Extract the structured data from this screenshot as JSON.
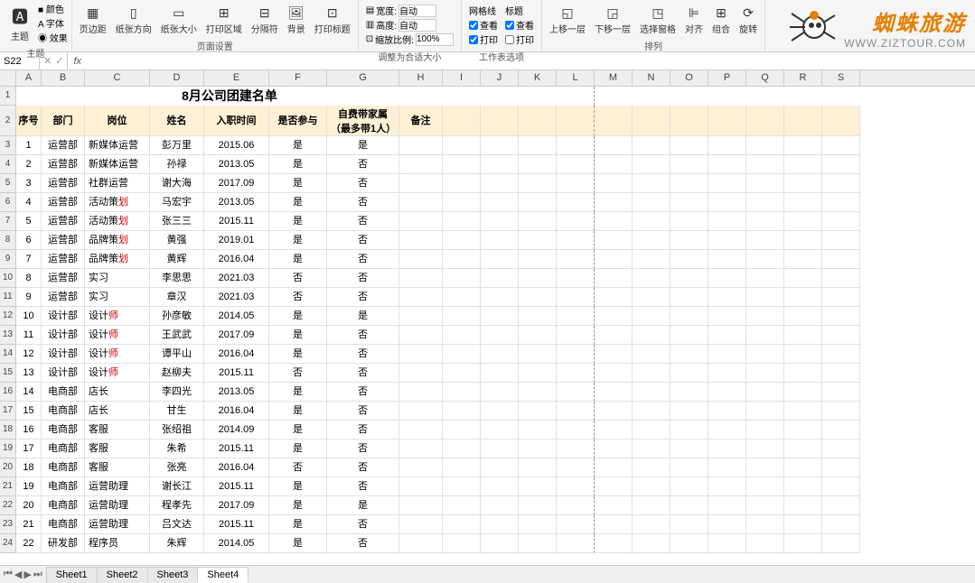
{
  "ribbon": {
    "theme": {
      "label": "主题",
      "sub1": "颜色",
      "sub2": "字体",
      "sub3": "效果",
      "group": "主题"
    },
    "page_setup": {
      "margins": "页边距",
      "orientation": "纸张方向",
      "size": "纸张大小",
      "print_area": "打印区域",
      "breaks": "分隔符",
      "background": "背景",
      "print_titles": "打印标题",
      "group": "页面设置"
    },
    "scale": {
      "width": "宽度:",
      "height": "高度:",
      "zoom": "缩放比例:",
      "auto": "自动",
      "zoom_val": "100%",
      "group": "调整为合适大小"
    },
    "sheet_opts": {
      "gridlines": "网格线",
      "headings": "标题",
      "view": "查看",
      "print": "打印",
      "group": "工作表选项"
    },
    "arrange": {
      "bring_fwd": "上移一层",
      "send_back": "下移一层",
      "selection": "选择窗格",
      "align": "对齐",
      "group_btn": "组合",
      "rotate": "旋转",
      "group": "排列"
    }
  },
  "watermark": {
    "title": "蜘蛛旅游",
    "url": "WWW.ZIZTOUR.COM"
  },
  "formula": {
    "cell_ref": "S22"
  },
  "cols": [
    "A",
    "B",
    "C",
    "D",
    "E",
    "F",
    "G",
    "H",
    "I",
    "J",
    "K",
    "L",
    "M",
    "N",
    "O",
    "P",
    "Q",
    "R",
    "S"
  ],
  "title": "8月公司团建名单",
  "headers": {
    "a": "序号",
    "b": "部门",
    "c": "岗位",
    "d": "姓名",
    "e": "入职时间",
    "f": "是否参与",
    "g": "自费带家属\n（最多带1人）",
    "h": "备注"
  },
  "rows": [
    {
      "n": "1",
      "dept": "运营部",
      "pos": "新媒体运营",
      "name": "彭万里",
      "date": "2015.06",
      "join": "是",
      "fam": "是"
    },
    {
      "n": "2",
      "dept": "运营部",
      "pos": "新媒体运营",
      "name": "孙禄",
      "date": "2013.05",
      "join": "是",
      "fam": "否"
    },
    {
      "n": "3",
      "dept": "运营部",
      "pos": "社群运营",
      "name": "谢大海",
      "date": "2017.09",
      "join": "是",
      "fam": "否"
    },
    {
      "n": "4",
      "dept": "运营部",
      "pos": "活动策划",
      "name": "马宏宇",
      "date": "2013.05",
      "join": "是",
      "fam": "否"
    },
    {
      "n": "5",
      "dept": "运营部",
      "pos": "活动策划",
      "name": "张三三",
      "date": "2015.11",
      "join": "是",
      "fam": "否"
    },
    {
      "n": "6",
      "dept": "运营部",
      "pos": "品牌策划",
      "name": "黄强",
      "date": "2019.01",
      "join": "是",
      "fam": "否"
    },
    {
      "n": "7",
      "dept": "运营部",
      "pos": "品牌策划",
      "name": "黄辉",
      "date": "2016.04",
      "join": "是",
      "fam": "否"
    },
    {
      "n": "8",
      "dept": "运营部",
      "pos": "实习",
      "name": "李思思",
      "date": "2021.03",
      "join": "否",
      "fam": "否"
    },
    {
      "n": "9",
      "dept": "运营部",
      "pos": "实习",
      "name": "章汉",
      "date": "2021.03",
      "join": "否",
      "fam": "否"
    },
    {
      "n": "10",
      "dept": "设计部",
      "pos": "设计师",
      "name": "孙彦敏",
      "date": "2014.05",
      "join": "是",
      "fam": "是"
    },
    {
      "n": "11",
      "dept": "设计部",
      "pos": "设计师",
      "name": "王武武",
      "date": "2017.09",
      "join": "是",
      "fam": "否"
    },
    {
      "n": "12",
      "dept": "设计部",
      "pos": "设计师",
      "name": "谭平山",
      "date": "2016.04",
      "join": "是",
      "fam": "否"
    },
    {
      "n": "13",
      "dept": "设计部",
      "pos": "设计师",
      "name": "赵柳夫",
      "date": "2015.11",
      "join": "否",
      "fam": "否"
    },
    {
      "n": "14",
      "dept": "电商部",
      "pos": "店长",
      "name": "李四光",
      "date": "2013.05",
      "join": "是",
      "fam": "否"
    },
    {
      "n": "15",
      "dept": "电商部",
      "pos": "店长",
      "name": "甘生",
      "date": "2016.04",
      "join": "是",
      "fam": "否"
    },
    {
      "n": "16",
      "dept": "电商部",
      "pos": "客服",
      "name": "张绍祖",
      "date": "2014.09",
      "join": "是",
      "fam": "否"
    },
    {
      "n": "17",
      "dept": "电商部",
      "pos": "客服",
      "name": "朱希",
      "date": "2015.11",
      "join": "是",
      "fam": "否"
    },
    {
      "n": "18",
      "dept": "电商部",
      "pos": "客服",
      "name": "张亮",
      "date": "2016.04",
      "join": "否",
      "fam": "否"
    },
    {
      "n": "19",
      "dept": "电商部",
      "pos": "运营助理",
      "name": "谢长江",
      "date": "2015.11",
      "join": "是",
      "fam": "否"
    },
    {
      "n": "20",
      "dept": "电商部",
      "pos": "运营助理",
      "name": "程孝先",
      "date": "2017.09",
      "join": "是",
      "fam": "是"
    },
    {
      "n": "21",
      "dept": "电商部",
      "pos": "运营助理",
      "name": "吕文达",
      "date": "2015.11",
      "join": "是",
      "fam": "否"
    },
    {
      "n": "22",
      "dept": "研发部",
      "pos": "程序员",
      "name": "朱辉",
      "date": "2014.05",
      "join": "是",
      "fam": "否"
    }
  ],
  "sheets": [
    "Sheet1",
    "Sheet2",
    "Sheet3",
    "Sheet4"
  ],
  "active_sheet": 3
}
